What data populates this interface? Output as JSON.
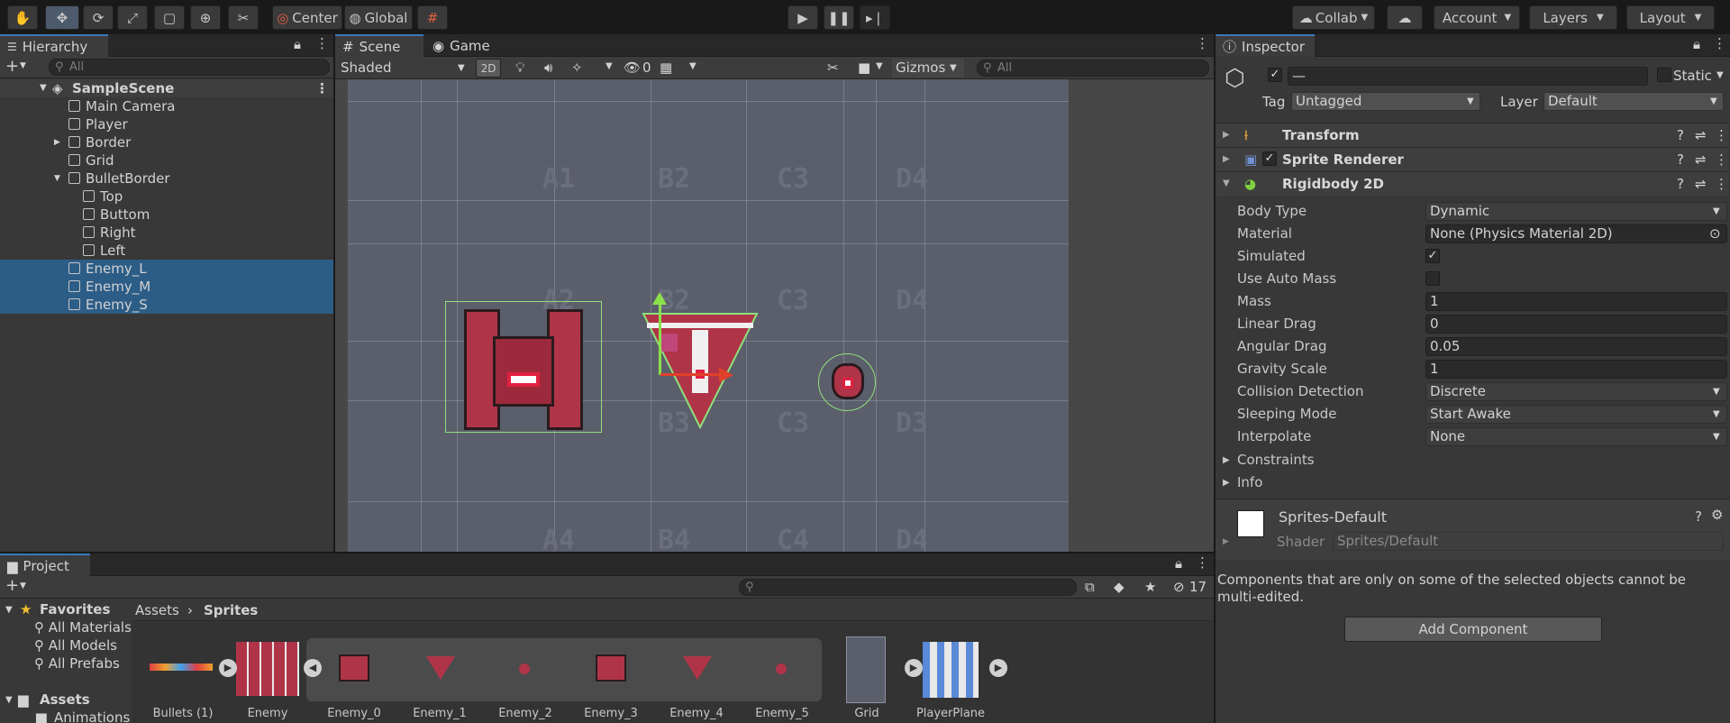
{
  "toolbar": {
    "center": "Center",
    "global": "Global",
    "collab": "Collab",
    "account": "Account",
    "layers": "Layers",
    "layout": "Layout"
  },
  "hierarchy": {
    "title": "Hierarchy",
    "search": "All",
    "scene": "SampleScene",
    "items": [
      "Main Camera",
      "Player",
      "Border",
      "Grid",
      "BulletBorder",
      "Top",
      "Buttom",
      "Right",
      "Left",
      "Enemy_L",
      "Enemy_M",
      "Enemy_S"
    ]
  },
  "scene": {
    "tab_scene": "Scene",
    "tab_game": "Game",
    "shading": "Shaded",
    "mode2d": "2D",
    "hidden_count": "0",
    "gizmos": "Gizmos",
    "search": "All",
    "cells": [
      "A1",
      "B2",
      "C3",
      "D4",
      "A2",
      "B2",
      "C3",
      "D4",
      "B3",
      "C3",
      "D3",
      "A4",
      "B4",
      "C4",
      "D4"
    ]
  },
  "inspector": {
    "title": "Inspector",
    "name_value": "—",
    "static": "Static",
    "tag_label": "Tag",
    "tag": "Untagged",
    "layer_label": "Layer",
    "layer": "Default",
    "components": [
      "Transform",
      "Sprite Renderer",
      "Rigidbody 2D"
    ],
    "fields": [
      {
        "label": "Body Type",
        "value": "Dynamic",
        "kind": "drop"
      },
      {
        "label": "Material",
        "value": "None (Physics Material 2D)",
        "kind": "obj"
      },
      {
        "label": "Simulated",
        "value": "✓",
        "kind": "check"
      },
      {
        "label": "Use Auto Mass",
        "value": "",
        "kind": "check"
      },
      {
        "label": "Mass",
        "value": "1",
        "kind": "text"
      },
      {
        "label": "Linear Drag",
        "value": "0",
        "kind": "text"
      },
      {
        "label": "Angular Drag",
        "value": "0.05",
        "kind": "text"
      },
      {
        "label": "Gravity Scale",
        "value": "1",
        "kind": "text"
      },
      {
        "label": "Collision Detection",
        "value": "Discrete",
        "kind": "drop"
      },
      {
        "label": "Sleeping Mode",
        "value": "Start Awake",
        "kind": "drop"
      },
      {
        "label": "Interpolate",
        "value": "None",
        "kind": "drop"
      }
    ],
    "foldouts": [
      "Constraints",
      "Info"
    ],
    "material_name": "Sprites-Default",
    "shader_label": "Shader",
    "shader": "Sprites/Default",
    "note": "Components that are only on some of the selected objects cannot be multi-edited.",
    "add_component": "Add Component"
  },
  "project": {
    "title": "Project",
    "hidden_count": "17",
    "favorites": "Favorites",
    "fav_items": [
      "All Materials",
      "All Models",
      "All Prefabs"
    ],
    "assets": "Assets",
    "animations": "Animations",
    "breadcrumb": [
      "Assets",
      "Sprites"
    ],
    "assets_list": [
      "Bullets (1)",
      "Enemy",
      "Enemy_0",
      "Enemy_1",
      "Enemy_2",
      "Enemy_3",
      "Enemy_4",
      "Enemy_5",
      "Grid",
      "PlayerPlane"
    ]
  },
  "colors": {
    "accent": "#3a79bb",
    "selection": "#2c5d87",
    "enemy": "#b03448",
    "collider": "#8ee07a"
  }
}
